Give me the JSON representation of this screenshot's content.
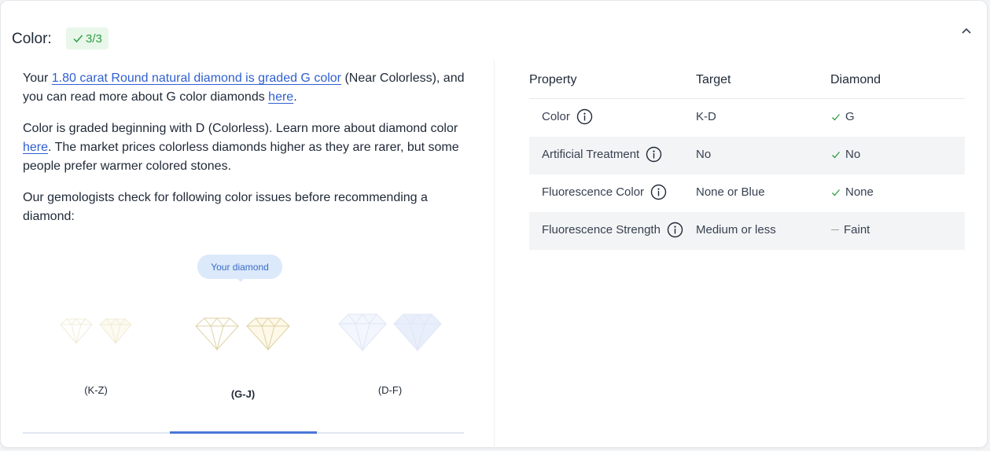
{
  "header": {
    "title": "Color:",
    "badge": "3/3"
  },
  "intro": {
    "p1_prefix": "Your ",
    "p1_link": "1.80 carat Round natural diamond is graded G color",
    "p1_middle": " (Near Colorless), and you can read more about G color diamonds ",
    "p1_link2": "here",
    "p1_suffix": ".",
    "p2_prefix": "Color is graded beginning with D (Colorless). Learn more about diamond color ",
    "p2_link": "here",
    "p2_suffix": ". The market prices colorless diamonds higher as they are rarer, but some people prefer warmer colored stones.",
    "p3": "Our gemologists check for following color issues before recommending a diamond:"
  },
  "scale": {
    "tooltip": "Your diamond",
    "grades": [
      "(K-Z)",
      "(G-J)",
      "(D-F)"
    ],
    "selected_index": 1
  },
  "table": {
    "headers": [
      "Property",
      "Target",
      "Diamond"
    ],
    "rows": [
      {
        "property": "Color",
        "target": "K-D",
        "diamond": "G",
        "status": "check"
      },
      {
        "property": "Artificial Treatment",
        "target": "No",
        "diamond": "No",
        "status": "check"
      },
      {
        "property": "Fluorescence Color",
        "target": "None or Blue",
        "diamond": "None",
        "status": "check"
      },
      {
        "property": "Fluorescence Strength",
        "target": "Medium or less",
        "diamond": "Faint",
        "status": "dash"
      }
    ]
  },
  "colors": {
    "link": "#2f5fd0",
    "check_green": "#2f9e44",
    "accent_blue": "#4a77d8"
  }
}
